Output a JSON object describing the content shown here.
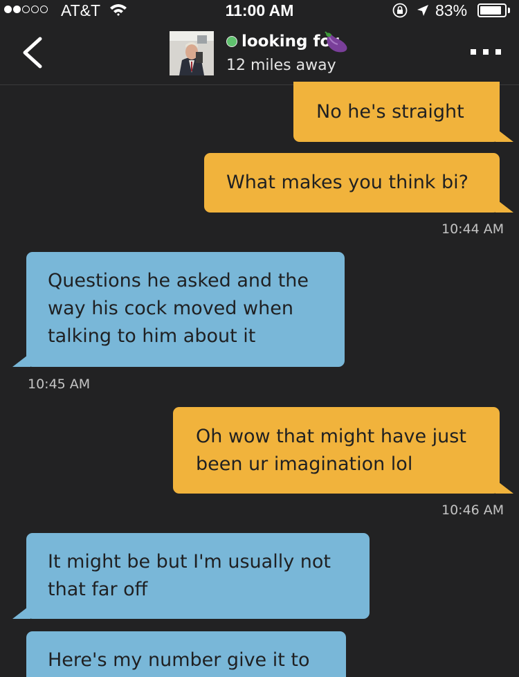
{
  "status_bar": {
    "carrier": "AT&T",
    "time": "11:00 AM",
    "battery_percent": "83%",
    "signal_bars_filled": 2,
    "signal_bars_total": 5,
    "battery_level": 0.83
  },
  "header": {
    "title": "looking for",
    "title_emoji": "eggplant-icon",
    "distance": "12 miles away",
    "online": true,
    "online_color": "#5fc16e"
  },
  "messages": [
    {
      "side": "out",
      "text": "No he's straight"
    },
    {
      "side": "out",
      "text": "What makes you think bi?"
    },
    {
      "side": "out",
      "timestamp": "10:44 AM"
    },
    {
      "side": "in",
      "lines": [
        "Questions he asked and the",
        "way his cock moved when",
        "talking to him about it"
      ]
    },
    {
      "side": "in",
      "timestamp": "10:45 AM"
    },
    {
      "side": "out",
      "lines": [
        "Oh wow that might have just",
        "been ur imagination lol"
      ]
    },
    {
      "side": "out",
      "timestamp": "10:46 AM"
    },
    {
      "side": "in",
      "lines": [
        "It might be but I'm usually not",
        "that far off"
      ]
    },
    {
      "side": "in",
      "lines": [
        "Here's my number give it to"
      ]
    }
  ],
  "colors": {
    "background": "#222223",
    "outgoing_bubble": "#f1b33c",
    "incoming_bubble": "#79b7d8",
    "bubble_text": "#1f2022"
  }
}
